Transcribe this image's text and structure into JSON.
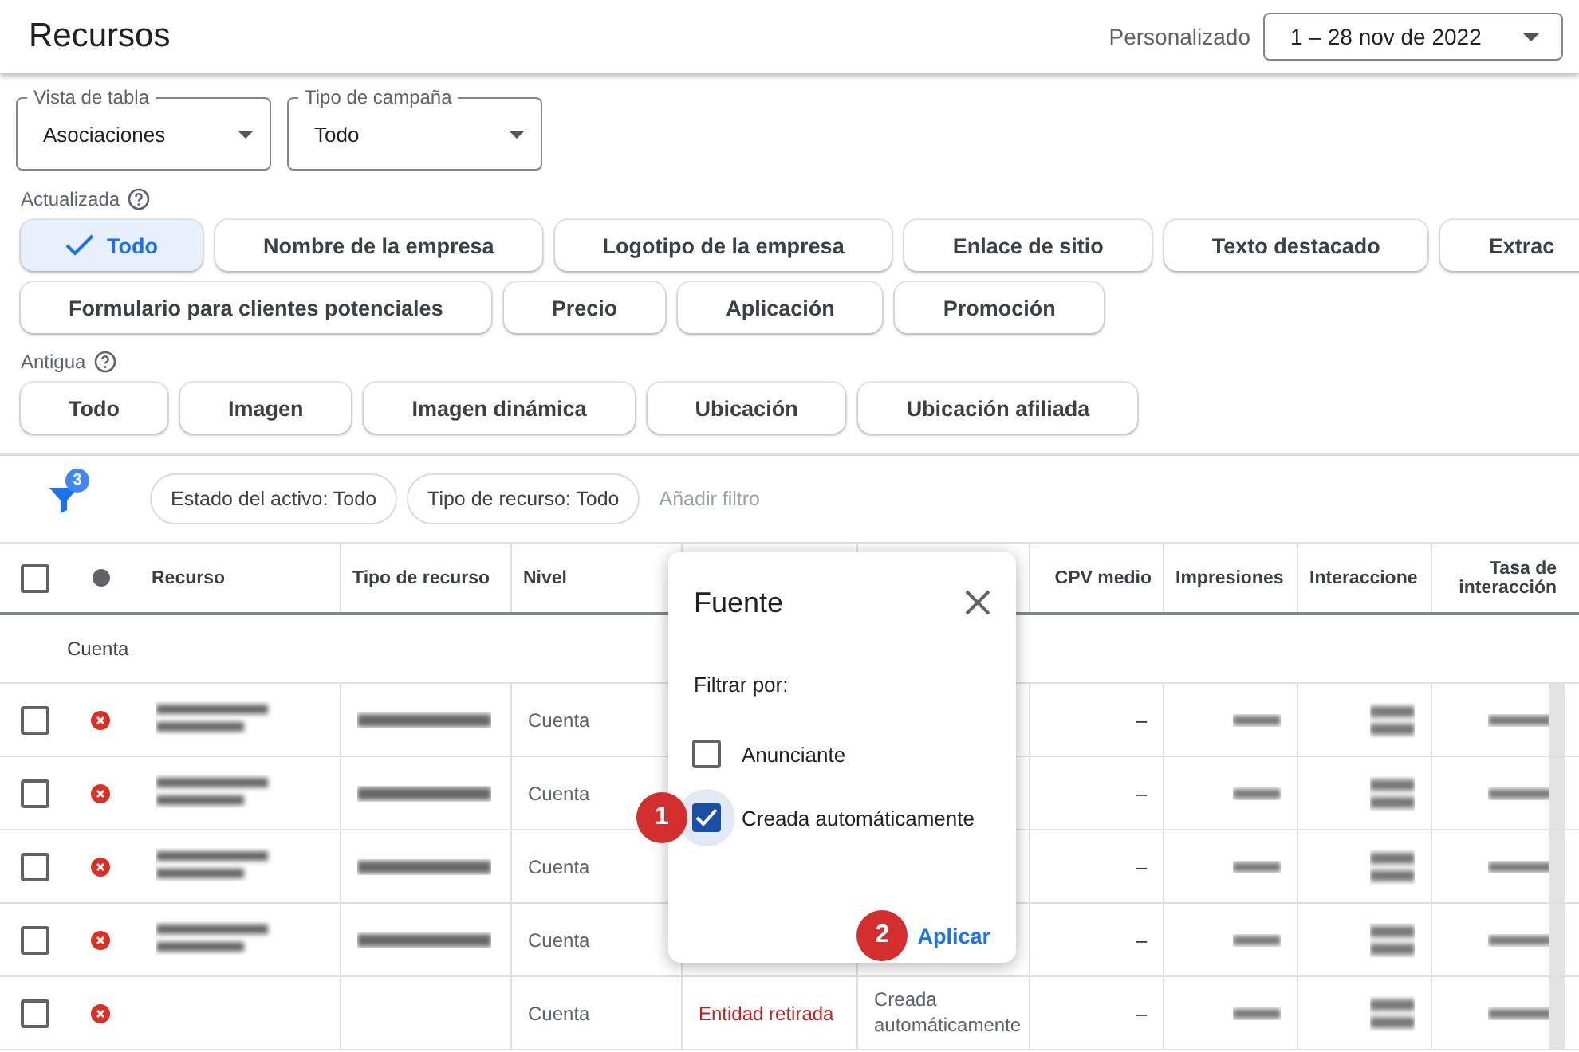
{
  "header": {
    "title": "Recursos",
    "date_label": "Personalizado",
    "date_range": "1 – 28 nov de 2022"
  },
  "dropdowns": [
    {
      "label": "Vista de tabla",
      "value": "Asociaciones"
    },
    {
      "label": "Tipo de campaña",
      "value": "Todo"
    }
  ],
  "chip_sections": [
    {
      "label": "Actualizada",
      "chip_rows": [
        [
          {
            "label": "Todo",
            "selected": true
          },
          {
            "label": "Nombre de la empresa",
            "selected": false
          },
          {
            "label": "Logotipo de la empresa",
            "selected": false
          },
          {
            "label": "Enlace de sitio",
            "selected": false
          },
          {
            "label": "Texto destacado",
            "selected": false
          },
          {
            "label": "Extrac",
            "selected": false
          }
        ],
        [
          {
            "label": "Formulario para clientes potenciales",
            "selected": false
          },
          {
            "label": "Precio",
            "selected": false
          },
          {
            "label": "Aplicación",
            "selected": false
          },
          {
            "label": "Promoción",
            "selected": false
          }
        ]
      ]
    },
    {
      "label": "Antigua",
      "chip_rows": [
        [
          {
            "label": "Todo",
            "selected": false
          },
          {
            "label": "Imagen",
            "selected": false
          },
          {
            "label": "Imagen dinámica",
            "selected": false
          },
          {
            "label": "Ubicación",
            "selected": false
          },
          {
            "label": "Ubicación afiliada",
            "selected": false
          }
        ]
      ]
    }
  ],
  "filter_bar": {
    "filter_count": "3",
    "chips": [
      "Estado del activo: Todo",
      "Tipo de recurso: Todo"
    ],
    "add_filter": "Añadir filtro"
  },
  "table": {
    "columns": [
      {
        "kind": "text",
        "label": "Recurso"
      },
      {
        "kind": "text",
        "label": "Tipo de recurso"
      },
      {
        "kind": "text",
        "label": "Nivel"
      },
      {
        "kind": "covered"
      },
      {
        "kind": "covered"
      },
      {
        "kind": "metric",
        "label": "CPV medio"
      },
      {
        "kind": "text",
        "label": "Impresiones"
      },
      {
        "kind": "text",
        "label": "Interaccione"
      },
      {
        "kind": "metric",
        "label": "Tasa de interacción"
      }
    ],
    "header_checked": false,
    "group_row": "Cuenta",
    "rows": [
      {
        "checked": false,
        "removed": true,
        "level": "Cuenta",
        "cpv": "–"
      },
      {
        "checked": false,
        "removed": true,
        "level": "Cuenta",
        "cpv": "–"
      },
      {
        "checked": false,
        "removed": true,
        "level": "Cuenta",
        "cpv": "–"
      },
      {
        "checked": false,
        "removed": true,
        "level": "Cuenta",
        "cpv": "–"
      },
      {
        "checked": false,
        "removed": true,
        "level": "Cuenta",
        "state_text": "Entidad retirada",
        "source": "Creada automáticamente",
        "cpv": "–"
      }
    ]
  },
  "popup": {
    "title": "Fuente",
    "filter_label": "Filtrar por:",
    "options": [
      {
        "label": "Anunciante",
        "checked": false
      },
      {
        "label": "Creada automáticamente",
        "checked": true,
        "step": "1"
      }
    ],
    "apply": "Aplicar",
    "apply_step": "2"
  }
}
